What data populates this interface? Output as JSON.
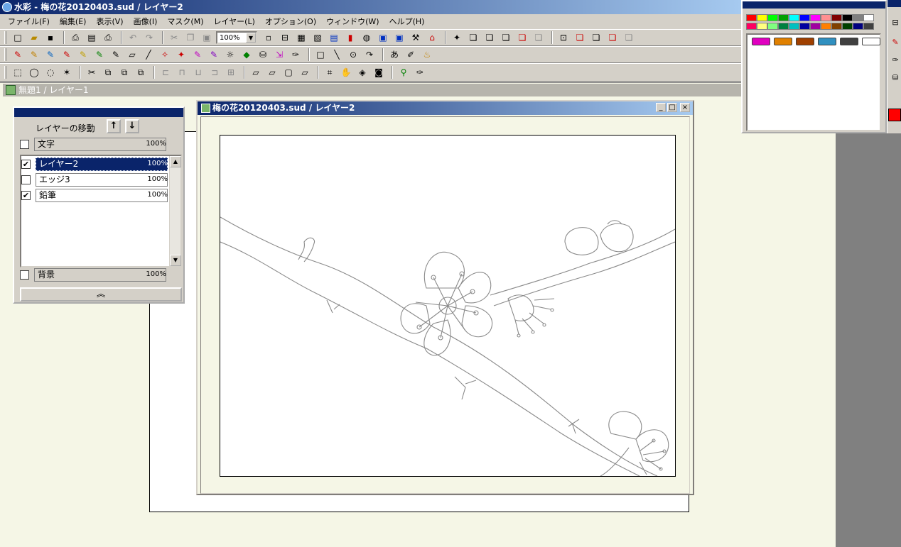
{
  "app": {
    "title": "水彩 - 梅の花20120403.sud / レイヤー2"
  },
  "menu": [
    "ファイル(F)",
    "編集(E)",
    "表示(V)",
    "画像(I)",
    "マスク(M)",
    "レイヤー(L)",
    "オプション(O)",
    "ウィンドウ(W)",
    "ヘルプ(H)"
  ],
  "toolbar": {
    "zoom": "100%"
  },
  "minimized_window": {
    "title": "無題1 / レイヤー1"
  },
  "document": {
    "title": "梅の花20120403.sud / レイヤー2",
    "min": "_",
    "max": "□",
    "close": "×"
  },
  "layer_panel": {
    "move_label": "レイヤーの移動",
    "up": "↑",
    "down": "↓",
    "top_layer": {
      "name": "文字",
      "opacity": "100%",
      "checked": ""
    },
    "layers": [
      {
        "name": "レイヤー2",
        "opacity": "100%",
        "checked": "✔"
      },
      {
        "name": "エッジ3",
        "opacity": "100%",
        "checked": ""
      },
      {
        "name": "鉛筆",
        "opacity": "100%",
        "checked": "✔"
      }
    ],
    "bottom_layer": {
      "name": "背景",
      "opacity": "100%",
      "checked": ""
    },
    "collapse": "︽",
    "scroll_up": "▲",
    "scroll_down": "▼"
  },
  "palette": {
    "colors_row1": [
      "#ff0000",
      "#ffff00",
      "#00ff00",
      "#00a000",
      "#00ffff",
      "#0000ff",
      "#ff00ff",
      "#ff9090",
      "#800000",
      "#000000",
      "#808080",
      "#ffffff"
    ],
    "colors_row2": [
      "#ff0060",
      "#ffff80",
      "#80ff80",
      "#008040",
      "#00c0c0",
      "#0000a0",
      "#a000a0",
      "#ff8000",
      "#804000",
      "#004000",
      "#000080",
      "#404040"
    ],
    "brushes": [
      "#e000c0",
      "#e08000",
      "#a04000",
      "#3090c0",
      "#404040",
      "#ffffff"
    ],
    "current_color": "#ff0000"
  }
}
